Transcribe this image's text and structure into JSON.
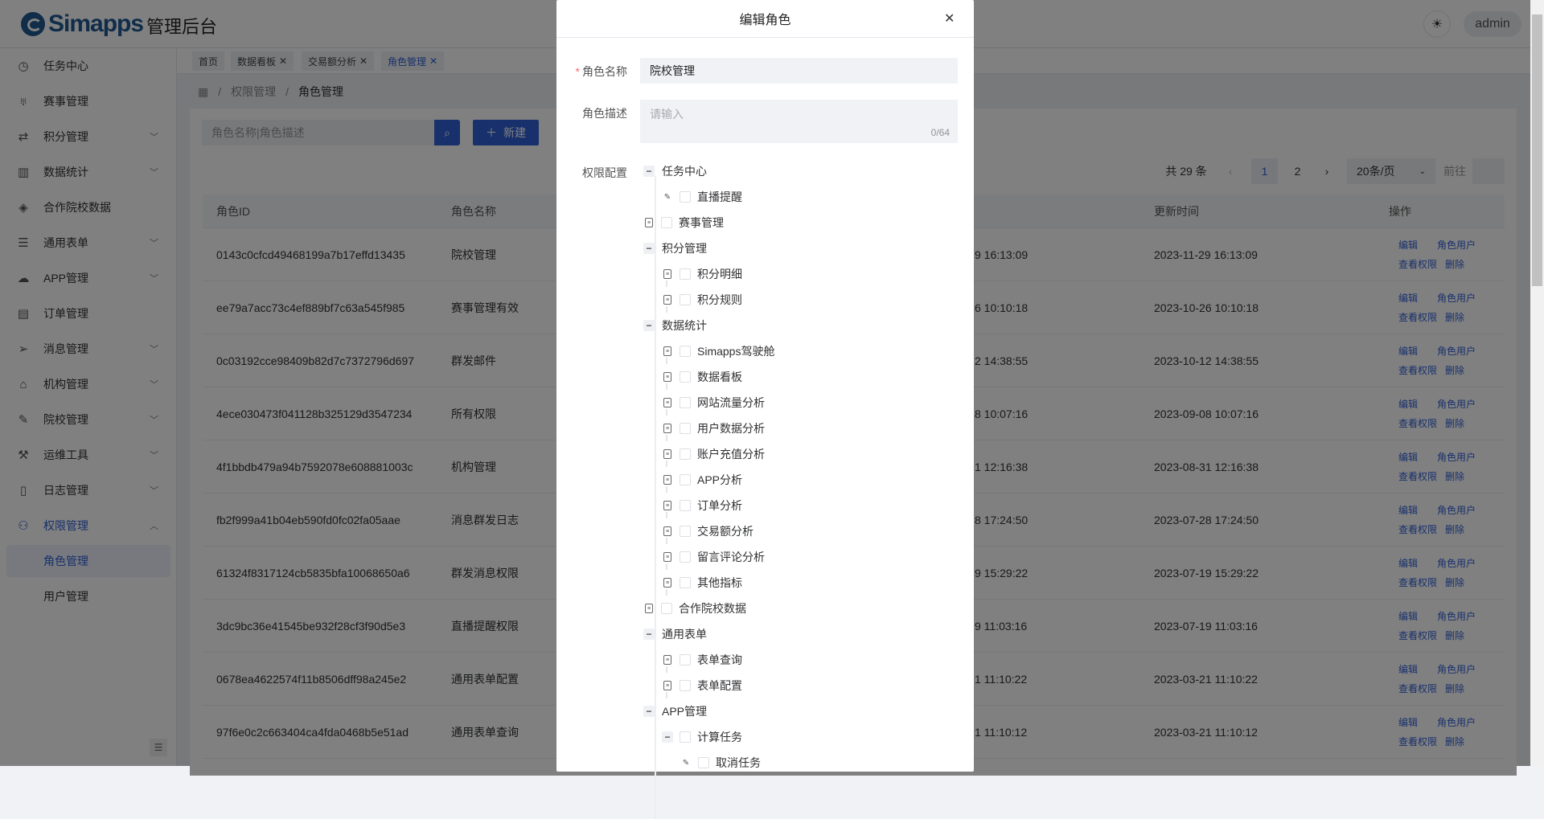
{
  "header": {
    "brand": "Simapps",
    "title": "管理后台",
    "theme_icon": "sun-icon",
    "user": "admin"
  },
  "sidebar": {
    "items": [
      {
        "label": "任务中心",
        "icon": "clock-icon",
        "chevron": false
      },
      {
        "label": "赛事管理",
        "icon": "trophy-icon",
        "chevron": false
      },
      {
        "label": "积分管理",
        "icon": "swap-icon",
        "chevron": true
      },
      {
        "label": "数据统计",
        "icon": "bar-chart-icon",
        "chevron": true
      },
      {
        "label": "合作院校数据",
        "icon": "layers-icon",
        "chevron": false
      },
      {
        "label": "通用表单",
        "icon": "list-icon",
        "chevron": true
      },
      {
        "label": "APP管理",
        "icon": "cloud-download-icon",
        "chevron": true
      },
      {
        "label": "订单管理",
        "icon": "book-icon",
        "chevron": false
      },
      {
        "label": "消息管理",
        "icon": "send-icon",
        "chevron": true
      },
      {
        "label": "机构管理",
        "icon": "home-icon",
        "chevron": true
      },
      {
        "label": "院校管理",
        "icon": "pencil-icon",
        "chevron": true
      },
      {
        "label": "运维工具",
        "icon": "wrench-icon",
        "chevron": true
      },
      {
        "label": "日志管理",
        "icon": "document-icon",
        "chevron": true
      },
      {
        "label": "权限管理",
        "icon": "users-icon",
        "chevron": true,
        "expanded": true,
        "active": true
      }
    ],
    "sub_items": [
      {
        "label": "角色管理",
        "selected": true
      },
      {
        "label": "用户管理",
        "selected": false
      }
    ]
  },
  "tabs": [
    {
      "label": "首页",
      "closable": false
    },
    {
      "label": "数据看板",
      "closable": true
    },
    {
      "label": "交易额分析",
      "closable": true
    },
    {
      "label": "角色管理",
      "closable": true,
      "active": true
    }
  ],
  "breadcrumb": [
    "权限管理",
    "角色管理"
  ],
  "toolbar": {
    "search_placeholder": "角色名称|角色描述",
    "new_label": "新建"
  },
  "pagination": {
    "total_text": "共 29 条",
    "pages": [
      "1",
      "2"
    ],
    "current": "1",
    "page_size": "20条/页",
    "goto_label": "前往"
  },
  "table": {
    "headers": {
      "id": "角色ID",
      "name": "角色名称",
      "update_time": "更新时间",
      "actions": "操作"
    },
    "action_labels": [
      "编辑",
      "角色用户",
      "查看权限",
      "删除"
    ],
    "rows": [
      {
        "id": "0143c0cfcd49468199a7b17effd13435",
        "name": "院校管理",
        "create_time_visible": "9 16:13:09",
        "update_time": "2023-11-29 16:13:09"
      },
      {
        "id": "ee79a7acc73c4ef889bf7c63a545f985",
        "name": "赛事管理有效",
        "create_time_visible": "6 10:10:18",
        "update_time": "2023-10-26 10:10:18"
      },
      {
        "id": "0c03192cce98409b82d7c7372796d697",
        "name": "群发邮件",
        "create_time_visible": "2 14:38:55",
        "update_time": "2023-10-12 14:38:55"
      },
      {
        "id": "4ece030473f041128b325129d3547234",
        "name": "所有权限",
        "create_time_visible": "8 10:07:16",
        "update_time": "2023-09-08 10:07:16"
      },
      {
        "id": "4f1bbdb479a94b7592078e608881003c",
        "name": "机构管理",
        "create_time_visible": "1 12:16:38",
        "update_time": "2023-08-31 12:16:38"
      },
      {
        "id": "fb2f999a41b04eb590fd0fc02fa05aae",
        "name": "消息群发日志",
        "create_time_visible": "8 17:24:50",
        "update_time": "2023-07-28 17:24:50"
      },
      {
        "id": "61324f8317124cb5835bfa10068650a6",
        "name": "群发消息权限",
        "create_time_visible": "9 15:29:22",
        "update_time": "2023-07-19 15:29:22"
      },
      {
        "id": "3dc9bc36e41545be932f28cf3f90d5e3",
        "name": "直播提醒权限",
        "create_time_visible": "9 11:03:16",
        "update_time": "2023-07-19 11:03:16"
      },
      {
        "id": "0678ea4622574f11b8506dff98a245e2",
        "name": "通用表单配置",
        "create_time_visible": "1 11:10:22",
        "update_time": "2023-03-21 11:10:22"
      },
      {
        "id": "97f6e0c2c663404ca4fda0468b5e51ad",
        "name": "通用表单查询",
        "create_time_visible": "1 11:10:12",
        "update_time": "2023-03-21 11:10:12"
      }
    ]
  },
  "modal": {
    "title": "编辑角色",
    "close_icon": "close-icon",
    "name_label": "角色名称",
    "name_value": "院校管理",
    "desc_label": "角色描述",
    "desc_placeholder": "请输入",
    "desc_count": "0/64",
    "perm_label": "权限配置",
    "tree": [
      {
        "level": 0,
        "label": "任务中心",
        "toggle": "minus",
        "checkbox": false
      },
      {
        "level": 1,
        "label": "直播提醒",
        "toggle": "pencil",
        "checkbox": true
      },
      {
        "level": 0,
        "label": "赛事管理",
        "toggle": "doc",
        "checkbox": true
      },
      {
        "level": 0,
        "label": "积分管理",
        "toggle": "minus",
        "checkbox": false
      },
      {
        "level": 1,
        "label": "积分明细",
        "toggle": "doc",
        "checkbox": true
      },
      {
        "level": 1,
        "label": "积分规则",
        "toggle": "doc",
        "checkbox": true
      },
      {
        "level": 0,
        "label": "数据统计",
        "toggle": "minus",
        "checkbox": false
      },
      {
        "level": 1,
        "label": "Simapps驾驶舱",
        "toggle": "doc",
        "checkbox": true
      },
      {
        "level": 1,
        "label": "数据看板",
        "toggle": "doc",
        "checkbox": true
      },
      {
        "level": 1,
        "label": "网站流量分析",
        "toggle": "doc",
        "checkbox": true
      },
      {
        "level": 1,
        "label": "用户数据分析",
        "toggle": "doc",
        "checkbox": true
      },
      {
        "level": 1,
        "label": "账户充值分析",
        "toggle": "doc",
        "checkbox": true
      },
      {
        "level": 1,
        "label": "APP分析",
        "toggle": "doc",
        "checkbox": true
      },
      {
        "level": 1,
        "label": "订单分析",
        "toggle": "doc",
        "checkbox": true
      },
      {
        "level": 1,
        "label": "交易额分析",
        "toggle": "doc",
        "checkbox": true
      },
      {
        "level": 1,
        "label": "留言评论分析",
        "toggle": "doc",
        "checkbox": true
      },
      {
        "level": 1,
        "label": "其他指标",
        "toggle": "doc",
        "checkbox": true
      },
      {
        "level": 0,
        "label": "合作院校数据",
        "toggle": "doc",
        "checkbox": true
      },
      {
        "level": 0,
        "label": "通用表单",
        "toggle": "minus",
        "checkbox": false
      },
      {
        "level": 1,
        "label": "表单查询",
        "toggle": "doc",
        "checkbox": true
      },
      {
        "level": 1,
        "label": "表单配置",
        "toggle": "doc",
        "checkbox": true
      },
      {
        "level": 0,
        "label": "APP管理",
        "toggle": "minus",
        "checkbox": false
      },
      {
        "level": 1,
        "label": "计算任务",
        "toggle": "minus",
        "checkbox": true
      },
      {
        "level": 2,
        "label": "取消任务",
        "toggle": "pencil",
        "checkbox": true
      }
    ]
  },
  "colors": {
    "primary": "#2f5fd6",
    "brand": "#1f5a93",
    "required": "#f56c6c"
  }
}
